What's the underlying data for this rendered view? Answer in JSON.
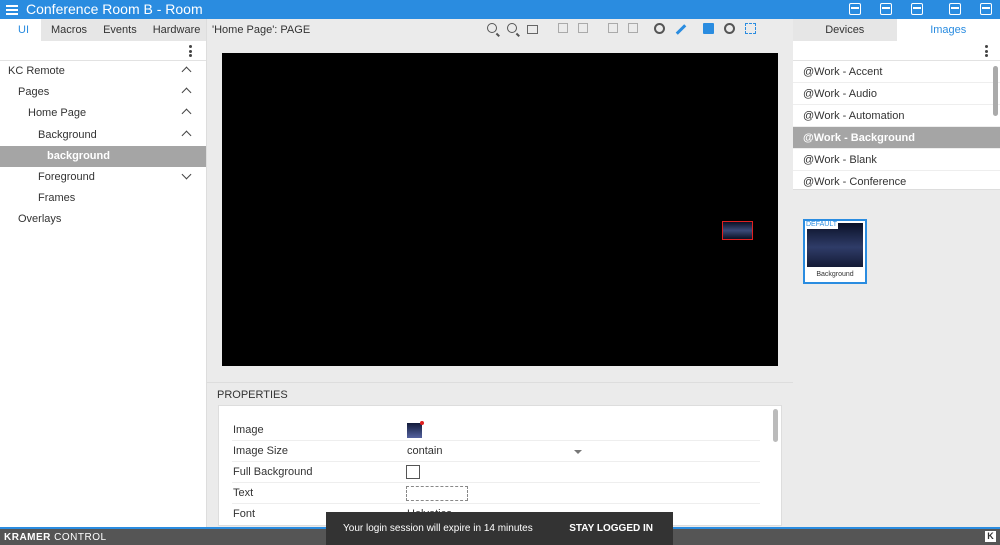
{
  "window": {
    "title": "Conference Room B - Room"
  },
  "left_tabs": [
    "UI",
    "Macros",
    "Events",
    "Hardware"
  ],
  "tree": [
    {
      "label": "KC Remote",
      "indent": 0,
      "chevron": "up",
      "selected": false
    },
    {
      "label": "Pages",
      "indent": 1,
      "chevron": "up",
      "selected": false
    },
    {
      "label": "Home Page",
      "indent": 2,
      "chevron": "up",
      "selected": false
    },
    {
      "label": "Background",
      "indent": 3,
      "chevron": "up",
      "selected": false
    },
    {
      "label": "background",
      "indent": 4,
      "chevron": "",
      "selected": true
    },
    {
      "label": "Foreground",
      "indent": 3,
      "chevron": "down",
      "selected": false
    },
    {
      "label": "Frames",
      "indent": 3,
      "chevron": "",
      "selected": false
    },
    {
      "label": "Overlays",
      "indent": 1,
      "chevron": "",
      "selected": false
    }
  ],
  "center": {
    "page_label": "'Home Page': PAGE",
    "tools": [
      "zoom-in-icon",
      "zoom-out-icon",
      "fit-icon",
      "align-icon",
      "distribute-icon",
      "lock-icon",
      "stack-icon",
      "record-icon",
      "pencil-icon",
      "image-icon",
      "target-icon",
      "layers-icon"
    ]
  },
  "properties": {
    "title": "PROPERTIES",
    "image_label": "Image",
    "image_size_label": "Image Size",
    "image_size_value": "contain",
    "full_background_label": "Full Background",
    "text_label": "Text",
    "font_label": "Font",
    "font_value_partial": "Helvetica"
  },
  "right_tabs": [
    "Devices",
    "Images"
  ],
  "images_list": [
    {
      "label": "@Work - Accent",
      "selected": false
    },
    {
      "label": "@Work - Audio",
      "selected": false
    },
    {
      "label": "@Work - Automation",
      "selected": false
    },
    {
      "label": "@Work - Background",
      "selected": true
    },
    {
      "label": "@Work - Blank",
      "selected": false
    },
    {
      "label": "@Work - Conference",
      "selected": false
    }
  ],
  "image_card": {
    "badge": "DEFAULT",
    "caption": "Background"
  },
  "bottom": {
    "brand_bold": "KRAMER",
    "brand_rest": "CONTROL",
    "logo": "K"
  },
  "toast": {
    "message": "Your login session will expire in 14 minutes",
    "action": "STAY LOGGED IN"
  },
  "colors": {
    "accent": "#2a8ce0",
    "selected_row": "#a5a5a5",
    "canvas": "#000000",
    "highlight": "#e02020"
  }
}
